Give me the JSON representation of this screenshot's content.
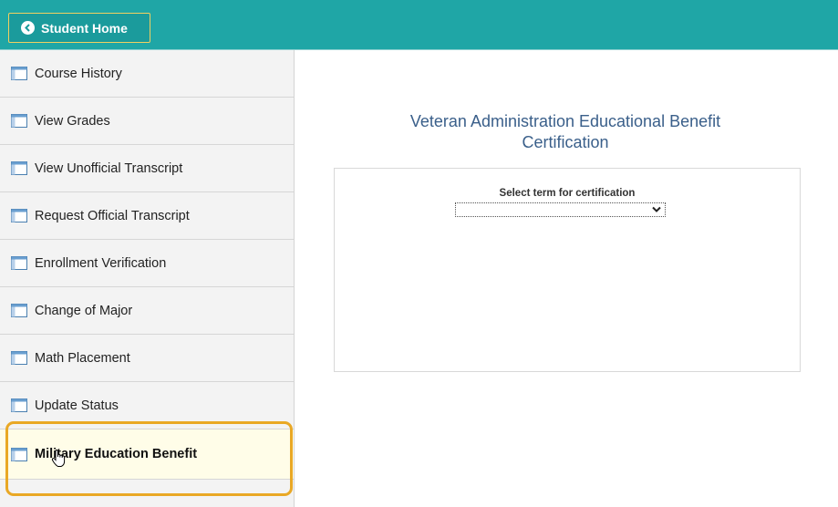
{
  "header": {
    "home_button_label": "Student Home"
  },
  "sidebar": {
    "items": [
      {
        "label": "Course History",
        "icon": "page-icon"
      },
      {
        "label": "View Grades",
        "icon": "page-icon"
      },
      {
        "label": "View Unofficial Transcript",
        "icon": "page-icon"
      },
      {
        "label": "Request Official Transcript",
        "icon": "page-icon"
      },
      {
        "label": "Enrollment Verification",
        "icon": "page-icon"
      },
      {
        "label": "Change of Major",
        "icon": "page-icon"
      },
      {
        "label": "Math Placement",
        "icon": "page-icon"
      },
      {
        "label": "Update Status",
        "icon": "page-icon"
      },
      {
        "label": "Military Education Benefit",
        "icon": "page-icon",
        "selected": true
      }
    ]
  },
  "main": {
    "title_line1": "Veteran Administration Educational Benefit",
    "title_line2": "Certification",
    "term_select": {
      "label": "Select term for certification",
      "value": ""
    }
  },
  "colors": {
    "header_bg": "#1fa6a6",
    "highlight_border": "#e9a825",
    "title_text": "#3a5f8a",
    "selected_bg": "#fffde8"
  }
}
